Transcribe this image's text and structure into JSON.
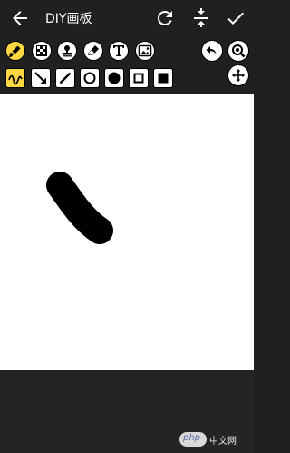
{
  "appbar": {
    "title": "DIY画板",
    "back_icon": "arrow-back-icon",
    "refresh_icon": "refresh-icon",
    "compress_icon": "compress-icon",
    "confirm_icon": "check-icon"
  },
  "toolbar": {
    "row1": [
      {
        "name": "brush",
        "icon": "brush-icon",
        "selected": true
      },
      {
        "name": "mosaic",
        "icon": "mosaic-icon",
        "selected": false
      },
      {
        "name": "stamp",
        "icon": "stamp-icon",
        "selected": false
      },
      {
        "name": "eraser",
        "icon": "eraser-icon",
        "selected": false
      },
      {
        "name": "text",
        "icon": "text-T-icon",
        "selected": false
      },
      {
        "name": "image",
        "icon": "image-icon",
        "selected": false
      }
    ],
    "row2": [
      {
        "name": "freehand",
        "icon": "squiggle-icon",
        "selected": true
      },
      {
        "name": "arrow",
        "icon": "arrow-line-icon",
        "selected": false
      },
      {
        "name": "line",
        "icon": "line-icon",
        "selected": false
      },
      {
        "name": "circle-outline",
        "icon": "circle-outline-icon",
        "selected": false
      },
      {
        "name": "circle-fill",
        "icon": "circle-fill-icon",
        "selected": false
      },
      {
        "name": "rect-outline",
        "icon": "rect-outline-icon",
        "selected": false
      },
      {
        "name": "rect-fill",
        "icon": "rect-fill-icon",
        "selected": false
      }
    ],
    "undo_icon": "undo-icon",
    "zoom_icon": "zoom-icon",
    "move_icon": "move-icon",
    "size_value": "8",
    "size_fraction": 0.02,
    "color": "#000000"
  },
  "watermark": {
    "php": "php",
    "site": "中文网"
  }
}
